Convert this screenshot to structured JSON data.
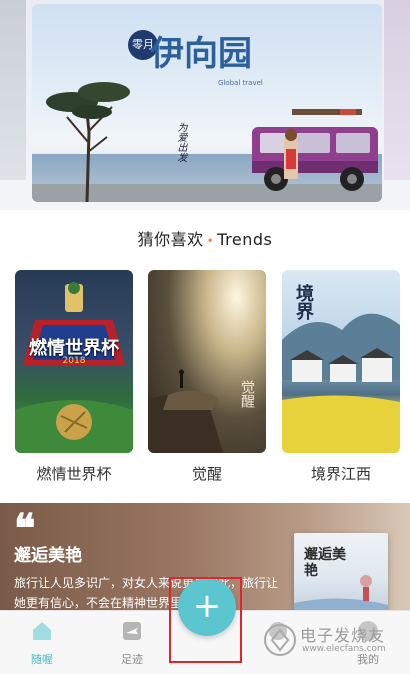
{
  "banner": {
    "badge": "零月",
    "title": "伊向园",
    "subtitle_en": "Global travel",
    "subtitle_cn": "为爱出发"
  },
  "section": {
    "title_cn": "猜你喜欢",
    "separator": "•",
    "title_en": "Trends"
  },
  "cards": [
    {
      "label": "燃情世界杯",
      "cover_title": "燃情世界杯",
      "cover_year": "2018"
    },
    {
      "label": "觉醒",
      "cover_title": "觉醒"
    },
    {
      "label": "境界江西",
      "cover_title": "境界"
    }
  ],
  "feature": {
    "quote_mark": "❝",
    "title": "邂逅美艳",
    "text": "旅行让人见多识广，对女人来说更是如此，旅行让她更有信心，不会在精神世界里迷失方向",
    "book_title": "邂逅美艳"
  },
  "nav": {
    "items": [
      {
        "label": "随喔",
        "icon": "home-icon"
      },
      {
        "label": "足迹",
        "icon": "plane-icon"
      },
      {
        "label": "",
        "icon": "message-icon"
      },
      {
        "label": "我的",
        "icon": "profile-icon"
      }
    ],
    "fab_label": "+"
  },
  "watermark": {
    "text_cn": "电子发烧友",
    "url": "www.elecfans.com"
  },
  "colors": {
    "accent": "#5cc6d0",
    "highlight": "#e0262a",
    "dot": "#f08a3c"
  }
}
